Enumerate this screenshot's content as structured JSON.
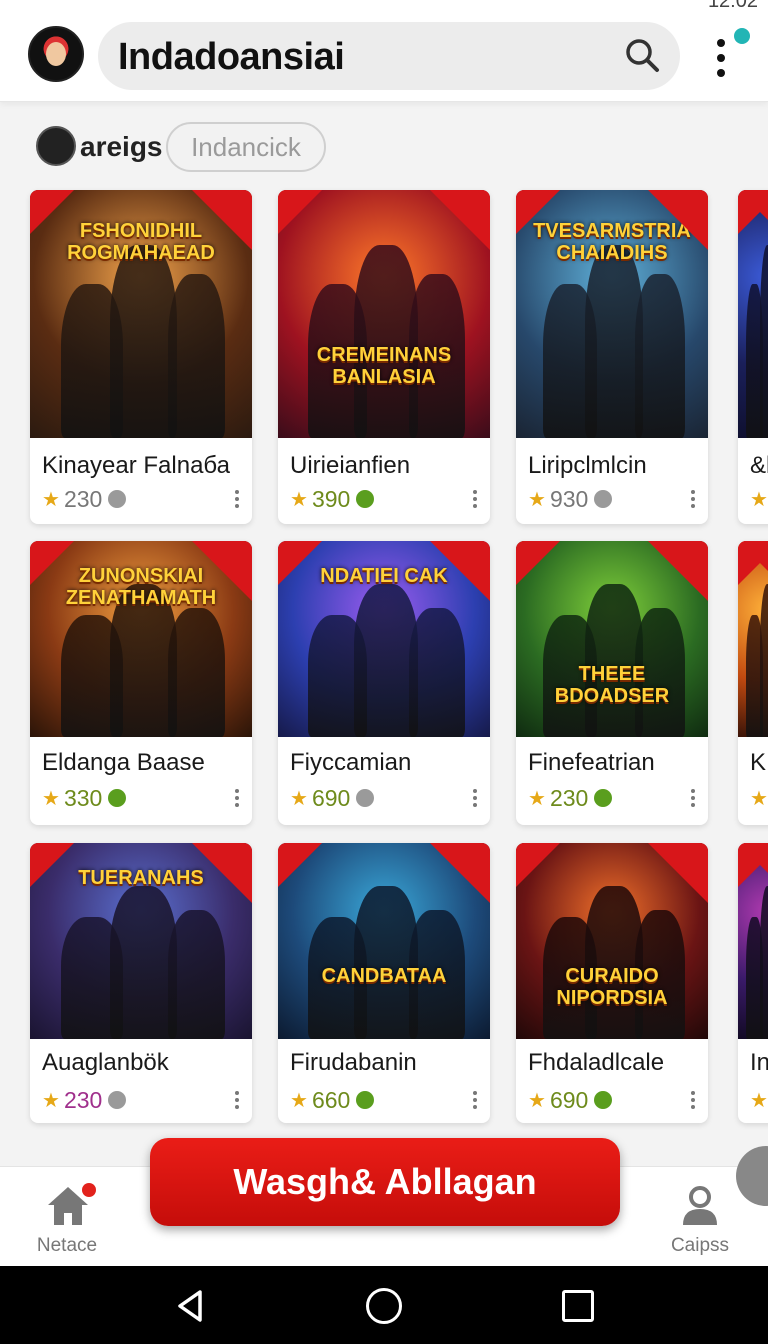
{
  "status_bar": {
    "time": "12:02"
  },
  "header": {
    "search_text": "Indadoansiai",
    "search_icon": "search-icon",
    "menu_icon": "more-vertical-icon"
  },
  "filter": {
    "label": "areigs",
    "chip": "Indancick"
  },
  "cards": [
    {
      "art": "FSHONIDHIL ROGMAHAEAD",
      "title": "Kinayear Falnaба",
      "rating": "230",
      "rating_color": "#777777",
      "coin_color": "#9a9a9a"
    },
    {
      "art": "CREMEINANS BANLASIA",
      "title": "Uirieianfien",
      "rating": "390",
      "rating_color": "#6e8b1c",
      "coin_color": "#5a9e1e"
    },
    {
      "art": "TVESARMSTRIA CHAIADIHS",
      "title": "Liripclmlcin",
      "rating": "930",
      "rating_color": "#777777",
      "coin_color": "#9a9a9a"
    },
    {
      "art": "",
      "title": "&l",
      "rating": "",
      "rating_color": "#777777",
      "coin_color": "#9a9a9a"
    },
    {
      "art": "ZUNONSKIAI ZENATHAMATH",
      "title": "Eldanga Baase",
      "rating": "330",
      "rating_color": "#6e8b1c",
      "coin_color": "#5a9e1e"
    },
    {
      "art": "NDATIEI CAK",
      "title": "Fiyccamian",
      "rating": "690",
      "rating_color": "#6e8b1c",
      "coin_color": "#9a9a9a"
    },
    {
      "art": "THEEE BDOADSER",
      "title": "Finefeatrian",
      "rating": "230",
      "rating_color": "#6e8b1c",
      "coin_color": "#5a9e1e"
    },
    {
      "art": "",
      "title": "K",
      "rating": "",
      "rating_color": "#777777",
      "coin_color": "#9a9a9a"
    },
    {
      "art": "TUERANAHS",
      "title": "Auaglanbök",
      "rating": "230",
      "rating_color": "#a0308c",
      "coin_color": "#9a9a9a"
    },
    {
      "art": "CANDBATAA",
      "title": "Firudabanin",
      "rating": "660",
      "rating_color": "#6e8b1c",
      "coin_color": "#5a9e1e"
    },
    {
      "art": "CURAIDO NIPORDSIA",
      "title": "Fhdaladlcale",
      "rating": "690",
      "rating_color": "#6e8b1c",
      "coin_color": "#5a9e1e"
    },
    {
      "art": "",
      "title": "In",
      "rating": "",
      "rating_color": "#777777",
      "coin_color": "#9a9a9a"
    }
  ],
  "cta": {
    "label": "Wasgh& Abllagan"
  },
  "bottom_nav": {
    "home_label": "Netace",
    "profile_label": "Caipss"
  },
  "colors": {
    "accent": "#e2221c",
    "teal": "#22b5b5"
  }
}
